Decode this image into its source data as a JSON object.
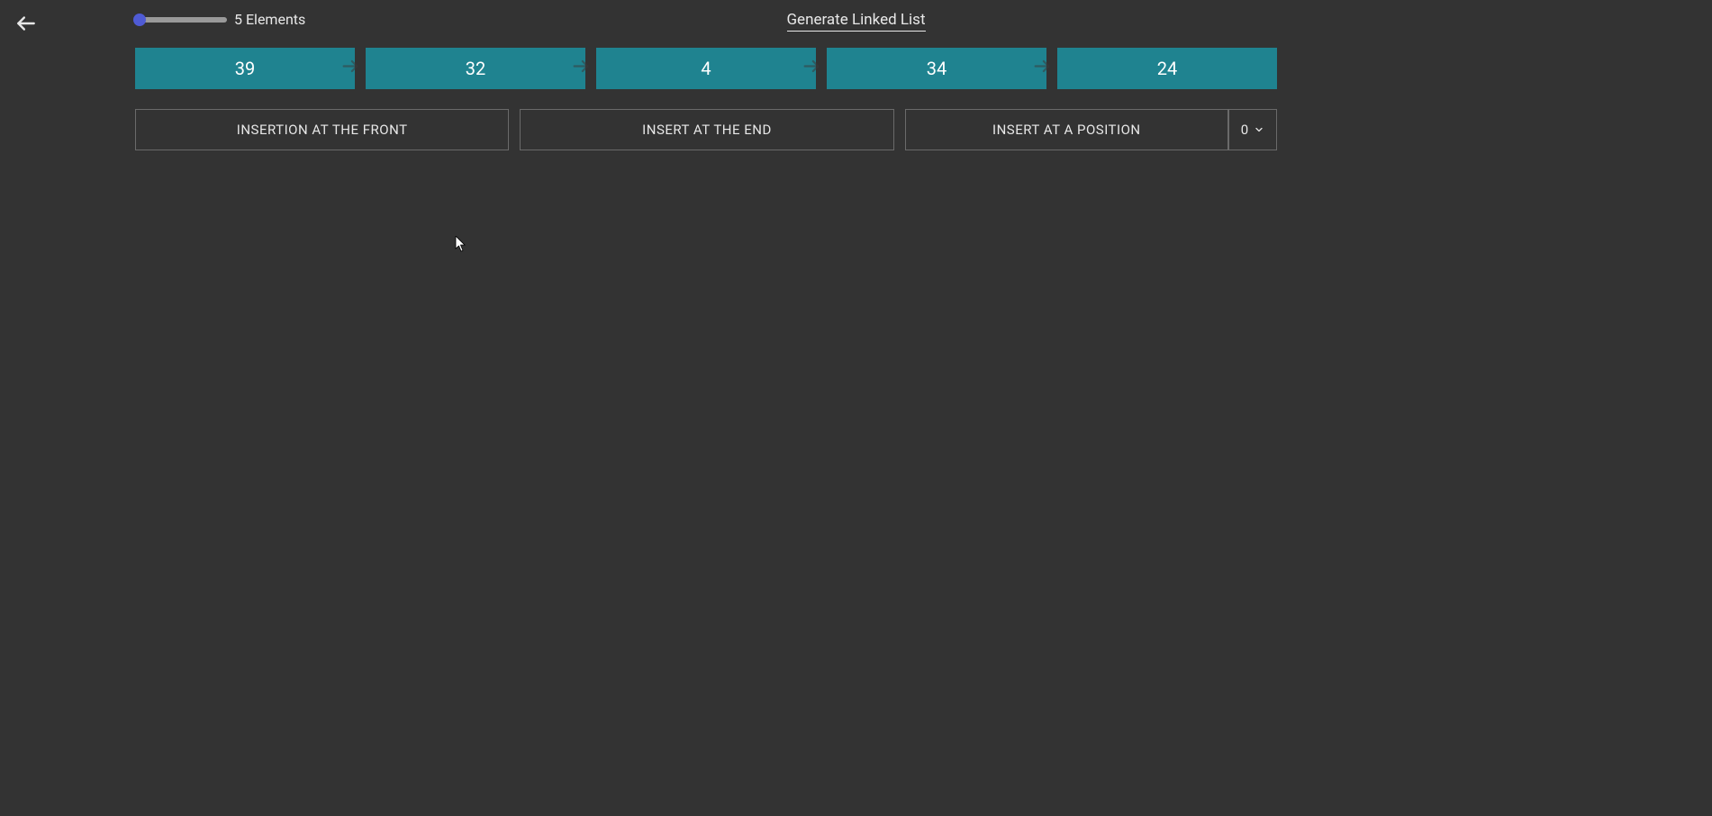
{
  "header": {
    "elements_label": "5 Elements",
    "generate_label": "Generate Linked List"
  },
  "nodes": [
    {
      "value": "39"
    },
    {
      "value": "32"
    },
    {
      "value": "4"
    },
    {
      "value": "34"
    },
    {
      "value": "24"
    }
  ],
  "buttons": {
    "insert_front": "INSERTION AT THE FRONT",
    "insert_end": "INSERT AT THE END",
    "insert_position": "INSERT AT A POSITION",
    "position_value": "0"
  },
  "colors": {
    "node_bg": "#1f8390",
    "bg": "#333333",
    "slider_thumb": "#4f5bd5"
  }
}
